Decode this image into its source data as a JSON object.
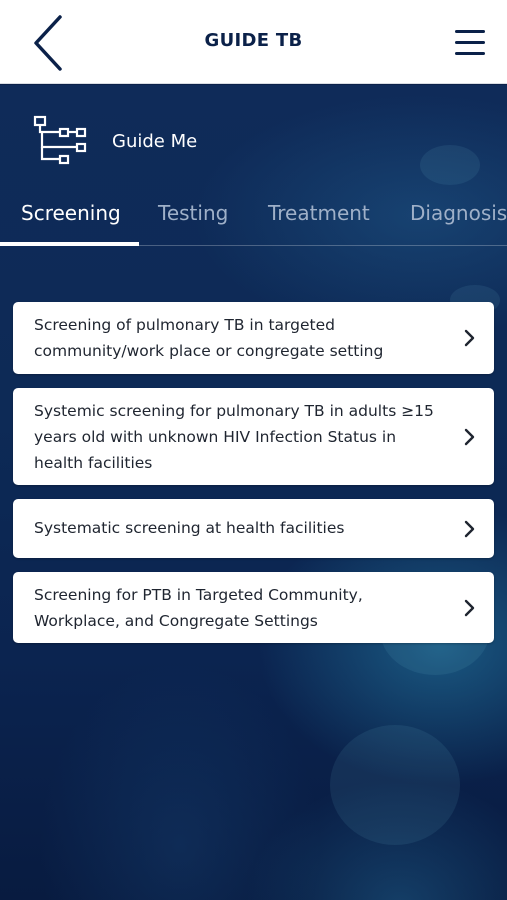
{
  "header": {
    "title": "GUIDE TB",
    "back_icon": "chevron-left-icon",
    "menu_icon": "hamburger-menu-icon"
  },
  "guide": {
    "label": "Guide Me",
    "icon": "flowchart-icon"
  },
  "tabs": [
    {
      "label": "Screening",
      "active": true
    },
    {
      "label": "Testing",
      "active": false
    },
    {
      "label": "Treatment",
      "active": false
    },
    {
      "label": "Diagnosis",
      "active": false
    }
  ],
  "cards": [
    {
      "text": "Screening of pulmonary TB in targeted community/work place or congregate setting"
    },
    {
      "text": "Systemic screening for pulmonary TB in adults ≥15 years old with unknown HIV Infection Status in health facilities"
    },
    {
      "text": "Systematic screening at health facilities"
    },
    {
      "text": "Screening for PTB in Targeted Community, Workplace, and Congregate Settings"
    }
  ],
  "colors": {
    "navy": "#0b2149",
    "card_bg": "#ffffff",
    "tab_inactive": "#9fb0c8"
  }
}
